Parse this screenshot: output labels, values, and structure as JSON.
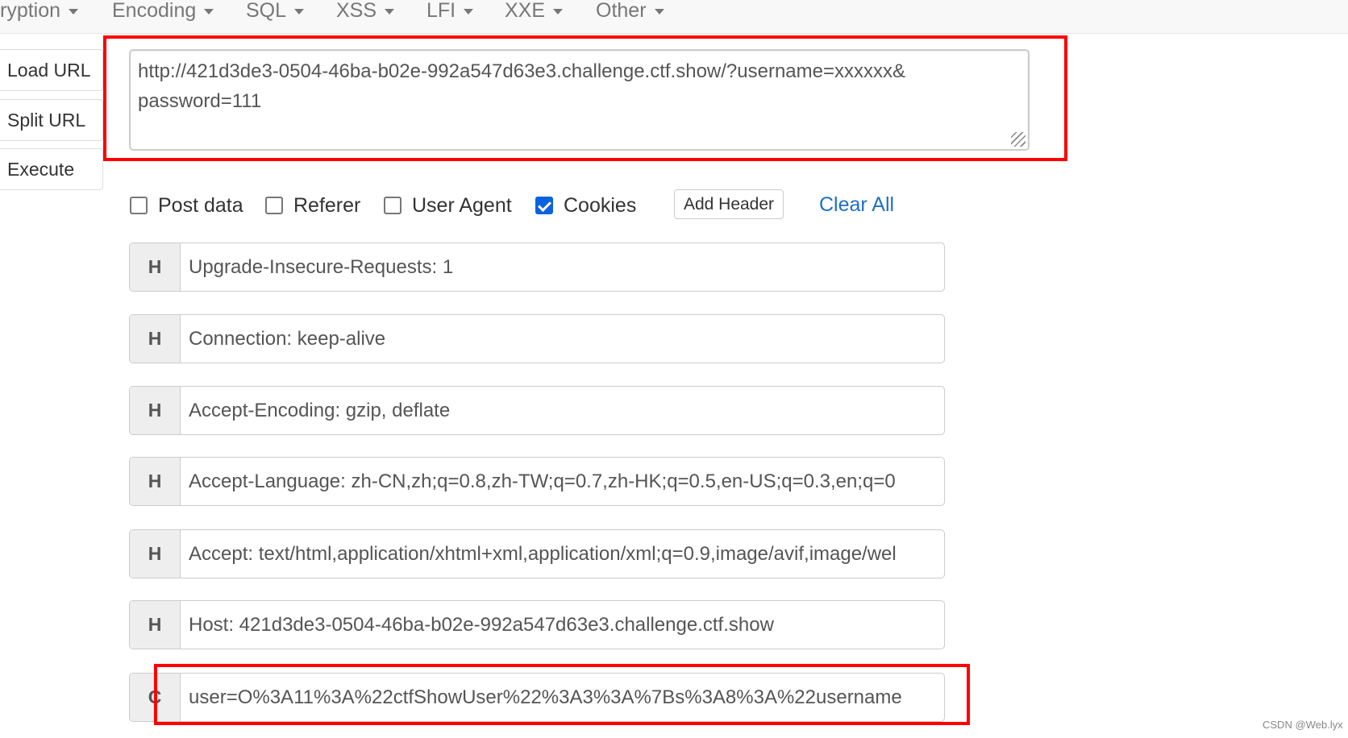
{
  "menu": [
    {
      "label": "ryption"
    },
    {
      "label": "Encoding"
    },
    {
      "label": "SQL"
    },
    {
      "label": "XSS"
    },
    {
      "label": "LFI"
    },
    {
      "label": "XXE"
    },
    {
      "label": "Other"
    }
  ],
  "side": {
    "load": "Load URL",
    "split": "Split URL",
    "execute": "Execute"
  },
  "url": "http://421d3de3-0504-46ba-b02e-992a547d63e3.challenge.ctf.show/?username=xxxxxx&\npassword=111",
  "options": [
    {
      "label": "Post data",
      "checked": false
    },
    {
      "label": "Referer",
      "checked": false
    },
    {
      "label": "User Agent",
      "checked": false
    },
    {
      "label": "Cookies",
      "checked": true
    }
  ],
  "add_header": "Add Header",
  "clear_all": "Clear All",
  "headers": [
    {
      "k": "H",
      "v": "Upgrade-Insecure-Requests: 1"
    },
    {
      "k": "H",
      "v": "Connection: keep-alive"
    },
    {
      "k": "H",
      "v": "Accept-Encoding: gzip, deflate"
    },
    {
      "k": "H",
      "v": "Accept-Language: zh-CN,zh;q=0.8,zh-TW;q=0.7,zh-HK;q=0.5,en-US;q=0.3,en;q=0"
    },
    {
      "k": "H",
      "v": "Accept: text/html,application/xhtml+xml,application/xml;q=0.9,image/avif,image/wel"
    },
    {
      "k": "H",
      "v": "Host: 421d3de3-0504-46ba-b02e-992a547d63e3.challenge.ctf.show"
    },
    {
      "k": "C",
      "v": "user=O%3A11%3A%22ctfShowUser%22%3A3%3A%7Bs%3A8%3A%22username"
    }
  ],
  "watermark": "CSDN @Web.lyx",
  "colors": {
    "highlight": "#ff0000",
    "checkbox": "#0b62e0",
    "link": "#1f6fc5"
  }
}
